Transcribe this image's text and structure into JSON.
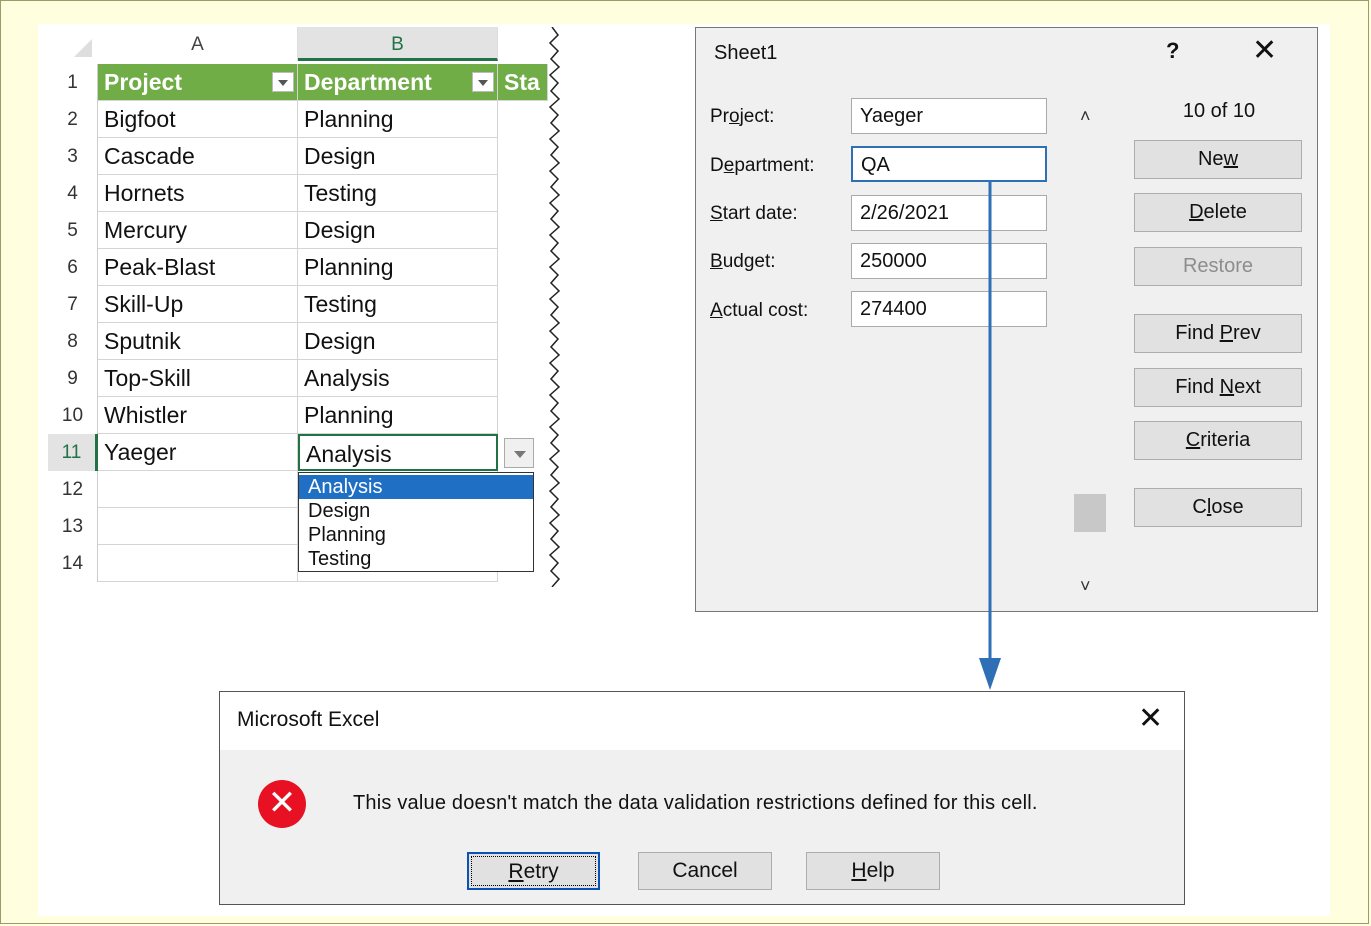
{
  "sheet": {
    "columns": [
      "A",
      "B"
    ],
    "rows": [
      "1",
      "2",
      "3",
      "4",
      "5",
      "6",
      "7",
      "8",
      "9",
      "10",
      "11",
      "12",
      "13",
      "14"
    ],
    "header": {
      "project": "Project",
      "department": "Department",
      "start_partial": "Sta"
    },
    "data": [
      {
        "project": "Bigfoot",
        "department": "Planning"
      },
      {
        "project": "Cascade",
        "department": "Design"
      },
      {
        "project": "Hornets",
        "department": "Testing"
      },
      {
        "project": "Mercury",
        "department": "Design"
      },
      {
        "project": "Peak-Blast",
        "department": "Planning"
      },
      {
        "project": "Skill-Up",
        "department": "Testing"
      },
      {
        "project": "Sputnik",
        "department": "Design"
      },
      {
        "project": "Top-Skill",
        "department": "Analysis"
      },
      {
        "project": "Whistler",
        "department": "Planning"
      },
      {
        "project": "Yaeger",
        "department": "Analysis"
      }
    ],
    "dropdown_options": [
      "Analysis",
      "Design",
      "Planning",
      "Testing"
    ],
    "dropdown_selected": "Analysis"
  },
  "form": {
    "title": "Sheet1",
    "help": "?",
    "close": "✕",
    "counter": "10 of 10",
    "fields": [
      {
        "label_pre": "Pr",
        "label_key": "o",
        "label_post": "ject:",
        "value": "Yaeger"
      },
      {
        "label_pre": "D",
        "label_key": "e",
        "label_post": "partment:",
        "value": "QA"
      },
      {
        "label_pre": "",
        "label_key": "S",
        "label_post": "tart date:",
        "value": "2/26/2021"
      },
      {
        "label_pre": "",
        "label_key": "B",
        "label_post": "udget:",
        "value": "250000"
      },
      {
        "label_pre": "",
        "label_key": "A",
        "label_post": "ctual cost:",
        "value": "274400"
      }
    ],
    "buttons": {
      "new": {
        "pre": "Ne",
        "key": "w",
        "post": ""
      },
      "delete": {
        "pre": "",
        "key": "D",
        "post": "elete"
      },
      "restore": {
        "pre": "",
        "key": "",
        "post": "Restore"
      },
      "find_prev": {
        "pre": "Find ",
        "key": "P",
        "post": "rev"
      },
      "find_next": {
        "pre": "Find ",
        "key": "N",
        "post": "ext"
      },
      "criteria": {
        "pre": "",
        "key": "C",
        "post": "riteria"
      },
      "close": {
        "pre": "C",
        "key": "l",
        "post": "ose"
      }
    }
  },
  "message": {
    "title": "Microsoft Excel",
    "close": "✕",
    "icon": "error-icon",
    "icon_glyph": "✕",
    "text": "This value doesn't match the data validation restrictions defined for this cell.",
    "buttons": {
      "retry": {
        "key": "R",
        "post": "etry"
      },
      "cancel": {
        "label": "Cancel"
      },
      "help": {
        "key": "H",
        "post": "elp"
      }
    }
  },
  "colors": {
    "header_green": "#70ad47",
    "excel_green": "#217346",
    "arrow_blue": "#2f6fb5",
    "error_red": "#e81123",
    "page_bg": "#ffffe0"
  }
}
